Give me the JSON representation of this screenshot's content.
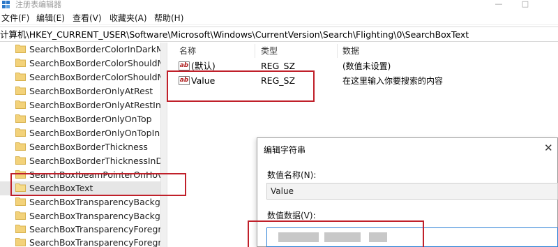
{
  "window": {
    "title": "注册表编辑器",
    "minimize": "—",
    "maximize": "□"
  },
  "menu": [
    "文件(F)",
    "编辑(E)",
    "查看(V)",
    "收藏夹(A)",
    "帮助(H)"
  ],
  "address": {
    "path": "计算机\\HKEY_CURRENT_USER\\Software\\Microsoft\\Windows\\CurrentVersion\\Search\\Flighting\\0\\SearchBoxText"
  },
  "tree": {
    "items": [
      {
        "label": "SearchBoxBorderColorInDarkMc"
      },
      {
        "label": "SearchBoxBorderColorShouldMa"
      },
      {
        "label": "SearchBoxBorderColorShouldMa"
      },
      {
        "label": "SearchBoxBorderOnlyAtRest"
      },
      {
        "label": "SearchBoxBorderOnlyAtRestInDa"
      },
      {
        "label": "SearchBoxBorderOnlyOnTop"
      },
      {
        "label": "SearchBoxBorderOnlyOnTopInD"
      },
      {
        "label": "SearchBoxBorderThickness"
      },
      {
        "label": "SearchBoxBorderThicknessInDar"
      },
      {
        "label": "SearchBoxIbeamPointerOnHover"
      },
      {
        "label": "SearchBoxText"
      },
      {
        "label": "SearchBoxTransparencyBackgro"
      },
      {
        "label": "SearchBoxTransparencyBackgro"
      },
      {
        "label": "SearchBoxTransparencyForegrou"
      },
      {
        "label": "SearchBoxTransparencyForegrou"
      }
    ]
  },
  "list": {
    "headers": {
      "name": "名称",
      "type": "类型",
      "data": "数据"
    },
    "rows": [
      {
        "icon": "ab",
        "name": "(默认)",
        "type": "REG_SZ",
        "data": "(数值未设置)"
      },
      {
        "icon": "ab",
        "name": "Value",
        "type": "REG_SZ",
        "data": "在这里输入你要搜索的内容"
      }
    ]
  },
  "dialog": {
    "title": "编辑字符串",
    "close": "✕",
    "name_label": "数值名称(N):",
    "name_value": "Value",
    "data_label": "数值数据(V):"
  },
  "colors": {
    "highlight": "#c0202a",
    "folder": "#f3d27a",
    "focus": "#2a7fd5"
  }
}
